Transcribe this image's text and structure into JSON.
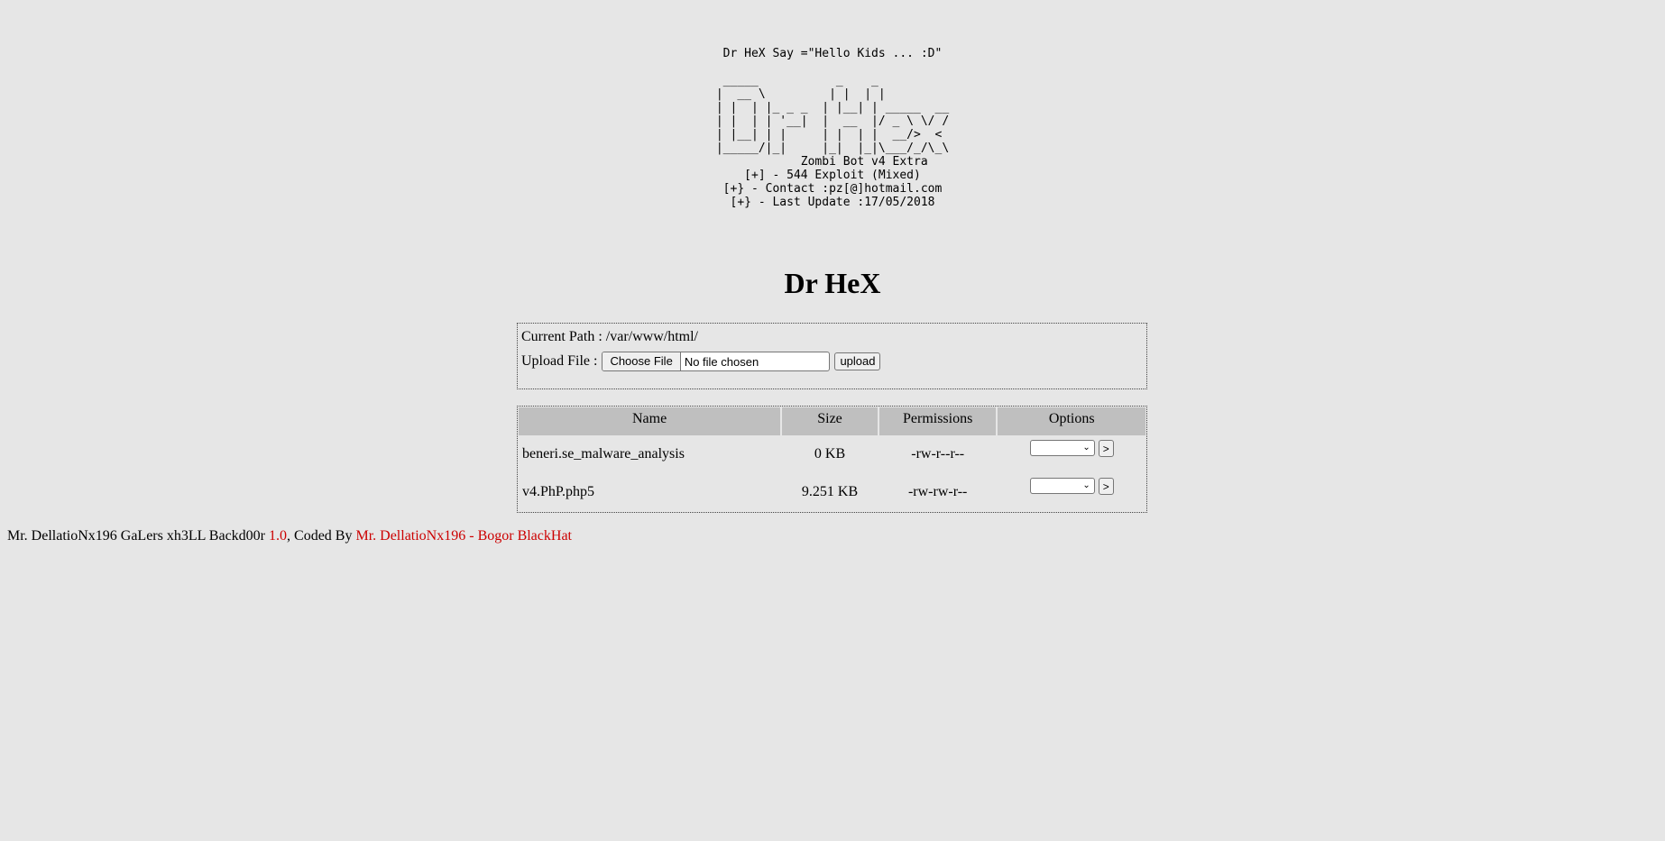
{
  "banner": {
    "say": "Dr HeX Say =\"Hello Kids ... :D\"",
    "ascii_art": " _____           _    _\n|  __ \\         | |  | |\n| |  | |_ _ _  | |__| | _____  __\n| |  | | '__|  |  __  |/ _ \\ \\/ /\n| |__| | |     | |  | |  __/>  <\n|_____/|_|     |_|  |_|\\___/_/\\_\\",
    "info": "            Zombi Bot v4 Extra\n    [+] - 544 Exploit (Mixed)\n [+} - Contact :pz[@]hotmail.com\n  [+} - Last Update :17/05/2018"
  },
  "title": "Dr HeX",
  "path": {
    "label": "Current Path : /var/www/html/"
  },
  "upload": {
    "label": "Upload File :",
    "choose_label": "Choose File",
    "no_file": "No file chosen",
    "button": "upload"
  },
  "table": {
    "headers": [
      "Name",
      "Size",
      "Permissions",
      "Options"
    ],
    "rows": [
      {
        "name": "beneri.se_malware_analysis",
        "size": "0 KB",
        "perms": "-rw-r--r--",
        "go": ">"
      },
      {
        "name": "v4.PhP.php5",
        "size": "9.251 KB",
        "perms": "-rw-rw-r--",
        "go": ">"
      }
    ]
  },
  "footer": {
    "text1": "Mr. DellatioNx196 GaLers xh3LL Backd00r ",
    "version": "1.0",
    "text2": ", Coded By ",
    "author": "Mr. DellatioNx196 - Bogor BlackHat"
  },
  "colors": {
    "background": "#e6e6e6",
    "header_bg": "#bfbfbf",
    "accent_red": "#cc0000"
  }
}
